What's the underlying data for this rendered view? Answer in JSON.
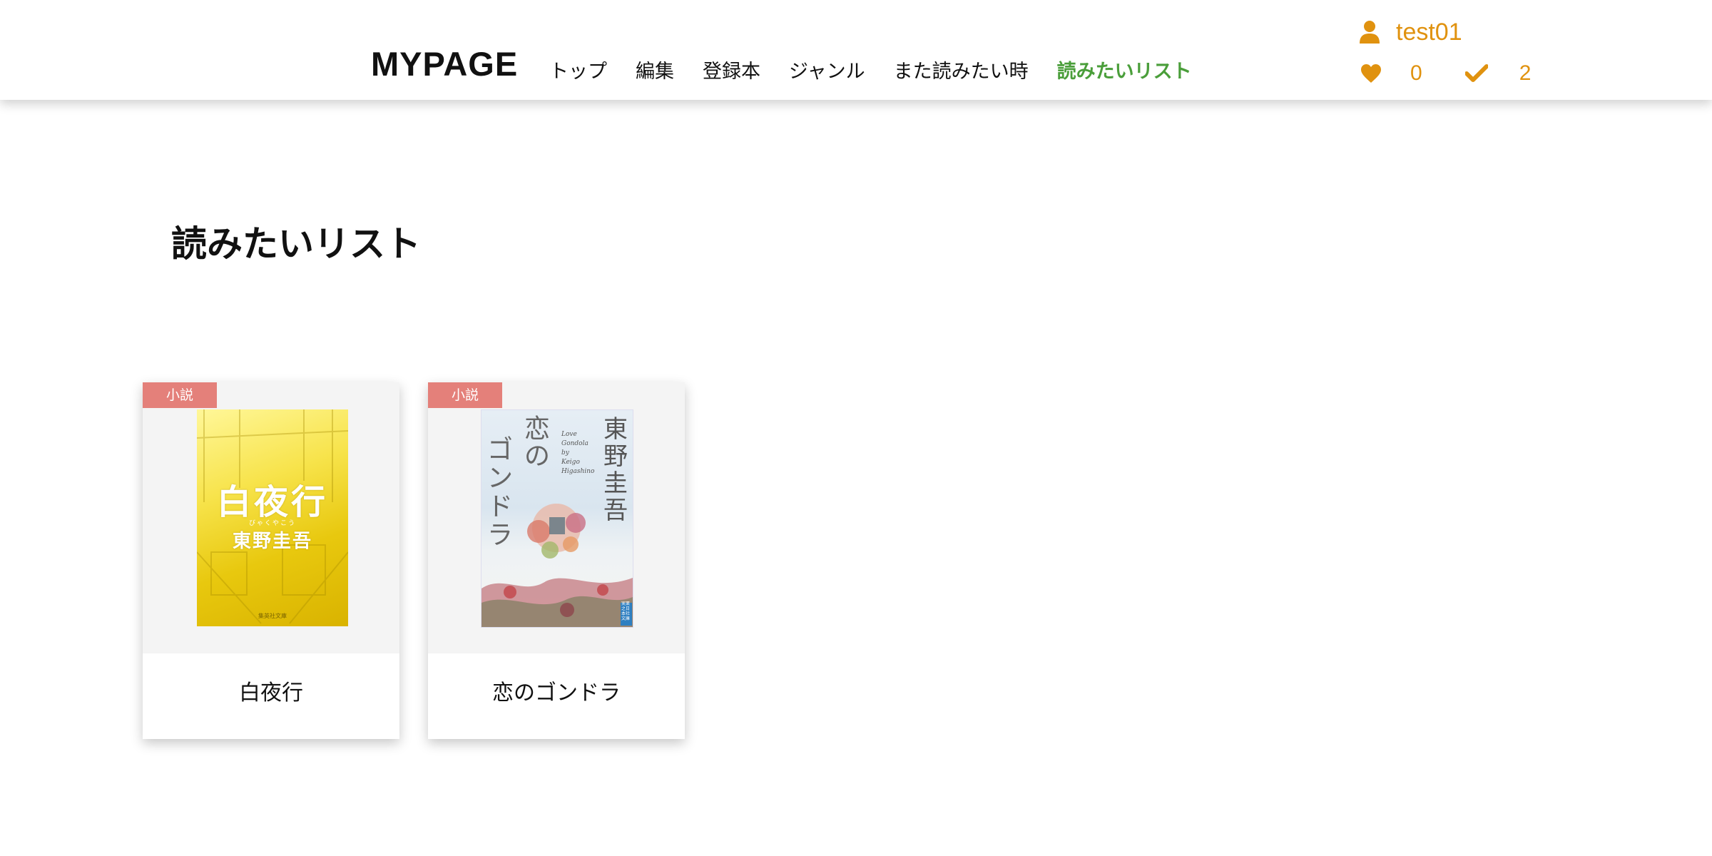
{
  "header": {
    "brand": "MYPAGE",
    "nav": [
      {
        "label": "トップ"
      },
      {
        "label": "編集"
      },
      {
        "label": "登録本"
      },
      {
        "label": "ジャンル"
      },
      {
        "label": "また読みたい時"
      },
      {
        "label": "読みたいリスト",
        "active": true
      }
    ],
    "user": {
      "icon": "user-icon",
      "name": "test01",
      "likes_icon": "heart-icon",
      "likes": "0",
      "read_icon": "check-icon",
      "read": "2"
    }
  },
  "colors": {
    "accent": "#e0920f",
    "active_nav": "#4a9e3a",
    "badge": "#e4807a"
  },
  "page": {
    "title": "読みたいリスト"
  },
  "books": [
    {
      "genre": "小説",
      "title": "白夜行",
      "cover_title": "白夜行",
      "cover_author": "東野圭吾",
      "cover_sub": "びゃくやこう",
      "cover_publisher": "集英社文庫"
    },
    {
      "genre": "小説",
      "title": "恋のゴンドラ",
      "cover_title_1": "恋の",
      "cover_title_2": "ゴンドラ",
      "cover_author": "東野圭吾",
      "cover_en_1": "Love",
      "cover_en_2": "Gondola",
      "cover_en_3": "by",
      "cover_en_4": "Keigo",
      "cover_en_5": "Higashino",
      "cover_publisher": "実業之日本社文庫"
    }
  ]
}
